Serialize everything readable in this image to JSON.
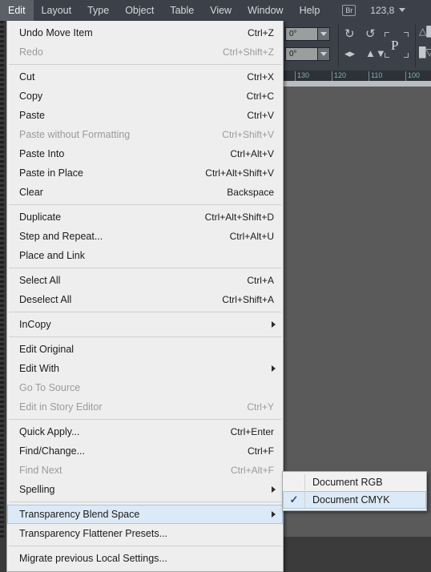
{
  "menubar": {
    "items": [
      {
        "label": "Edit",
        "active": true
      },
      {
        "label": "Layout",
        "active": false
      },
      {
        "label": "Type",
        "active": false
      },
      {
        "label": "Object",
        "active": false
      },
      {
        "label": "Table",
        "active": false
      },
      {
        "label": "View",
        "active": false
      },
      {
        "label": "Window",
        "active": false
      },
      {
        "label": "Help",
        "active": false
      }
    ],
    "bridge_label": "Br",
    "zoom_level": "123,8",
    "grid_icon": "arrange-documents-icon",
    "caret_icon": "chevron-down-icon"
  },
  "controlbar": {
    "rotation_angle": "0°",
    "shear_angle": "0°",
    "reference_point": "P",
    "icons": [
      "rotate-clockwise-icon",
      "rotate-counterclockwise-icon",
      "flip-horizontal-icon",
      "flip-vertical-icon",
      "distribute-top-icon",
      "distribute-bottom-icon"
    ]
  },
  "ruler": {
    "labels": [
      "130",
      "120",
      "110",
      "100"
    ]
  },
  "edit_menu": {
    "groups": [
      [
        {
          "label": "Undo Move Item",
          "accel": "Ctrl+Z",
          "disabled": false,
          "submenu": false
        },
        {
          "label": "Redo",
          "accel": "Ctrl+Shift+Z",
          "disabled": true,
          "submenu": false
        }
      ],
      [
        {
          "label": "Cut",
          "accel": "Ctrl+X",
          "disabled": false,
          "submenu": false
        },
        {
          "label": "Copy",
          "accel": "Ctrl+C",
          "disabled": false,
          "submenu": false
        },
        {
          "label": "Paste",
          "accel": "Ctrl+V",
          "disabled": false,
          "submenu": false
        },
        {
          "label": "Paste without Formatting",
          "accel": "Ctrl+Shift+V",
          "disabled": true,
          "submenu": false
        },
        {
          "label": "Paste Into",
          "accel": "Ctrl+Alt+V",
          "disabled": false,
          "submenu": false
        },
        {
          "label": "Paste in Place",
          "accel": "Ctrl+Alt+Shift+V",
          "disabled": false,
          "submenu": false
        },
        {
          "label": "Clear",
          "accel": "Backspace",
          "disabled": false,
          "submenu": false
        }
      ],
      [
        {
          "label": "Duplicate",
          "accel": "Ctrl+Alt+Shift+D",
          "disabled": false,
          "submenu": false
        },
        {
          "label": "Step and Repeat...",
          "accel": "Ctrl+Alt+U",
          "disabled": false,
          "submenu": false
        },
        {
          "label": "Place and Link",
          "accel": "",
          "disabled": false,
          "submenu": false
        }
      ],
      [
        {
          "label": "Select All",
          "accel": "Ctrl+A",
          "disabled": false,
          "submenu": false
        },
        {
          "label": "Deselect All",
          "accel": "Ctrl+Shift+A",
          "disabled": false,
          "submenu": false
        }
      ],
      [
        {
          "label": "InCopy",
          "accel": "",
          "disabled": false,
          "submenu": true
        }
      ],
      [
        {
          "label": "Edit Original",
          "accel": "",
          "disabled": false,
          "submenu": false
        },
        {
          "label": "Edit With",
          "accel": "",
          "disabled": false,
          "submenu": true
        },
        {
          "label": "Go To Source",
          "accel": "",
          "disabled": true,
          "submenu": false
        },
        {
          "label": "Edit in Story Editor",
          "accel": "Ctrl+Y",
          "disabled": true,
          "submenu": false
        }
      ],
      [
        {
          "label": "Quick Apply...",
          "accel": "Ctrl+Enter",
          "disabled": false,
          "submenu": false
        },
        {
          "label": "Find/Change...",
          "accel": "Ctrl+F",
          "disabled": false,
          "submenu": false
        },
        {
          "label": "Find Next",
          "accel": "Ctrl+Alt+F",
          "disabled": true,
          "submenu": false
        },
        {
          "label": "Spelling",
          "accel": "",
          "disabled": false,
          "submenu": true
        }
      ],
      [
        {
          "label": "Transparency Blend Space",
          "accel": "",
          "disabled": false,
          "submenu": true,
          "selected": true
        },
        {
          "label": "Transparency Flattener Presets...",
          "accel": "",
          "disabled": false,
          "submenu": false
        }
      ],
      [
        {
          "label": "Migrate previous Local Settings...",
          "accel": "",
          "disabled": false,
          "submenu": false
        }
      ]
    ]
  },
  "submenu": {
    "items": [
      {
        "label": "Document RGB",
        "checked": false,
        "selected": false
      },
      {
        "label": "Document CMYK",
        "checked": true,
        "selected": true
      }
    ],
    "check_glyph": "✓"
  },
  "colors": {
    "chrome": "#3c4049",
    "menu_bg": "#eeeeee",
    "highlight": "#dceaf7",
    "highlight_border": "#a8c7e6",
    "ruler_text": "#7fb4b0"
  }
}
